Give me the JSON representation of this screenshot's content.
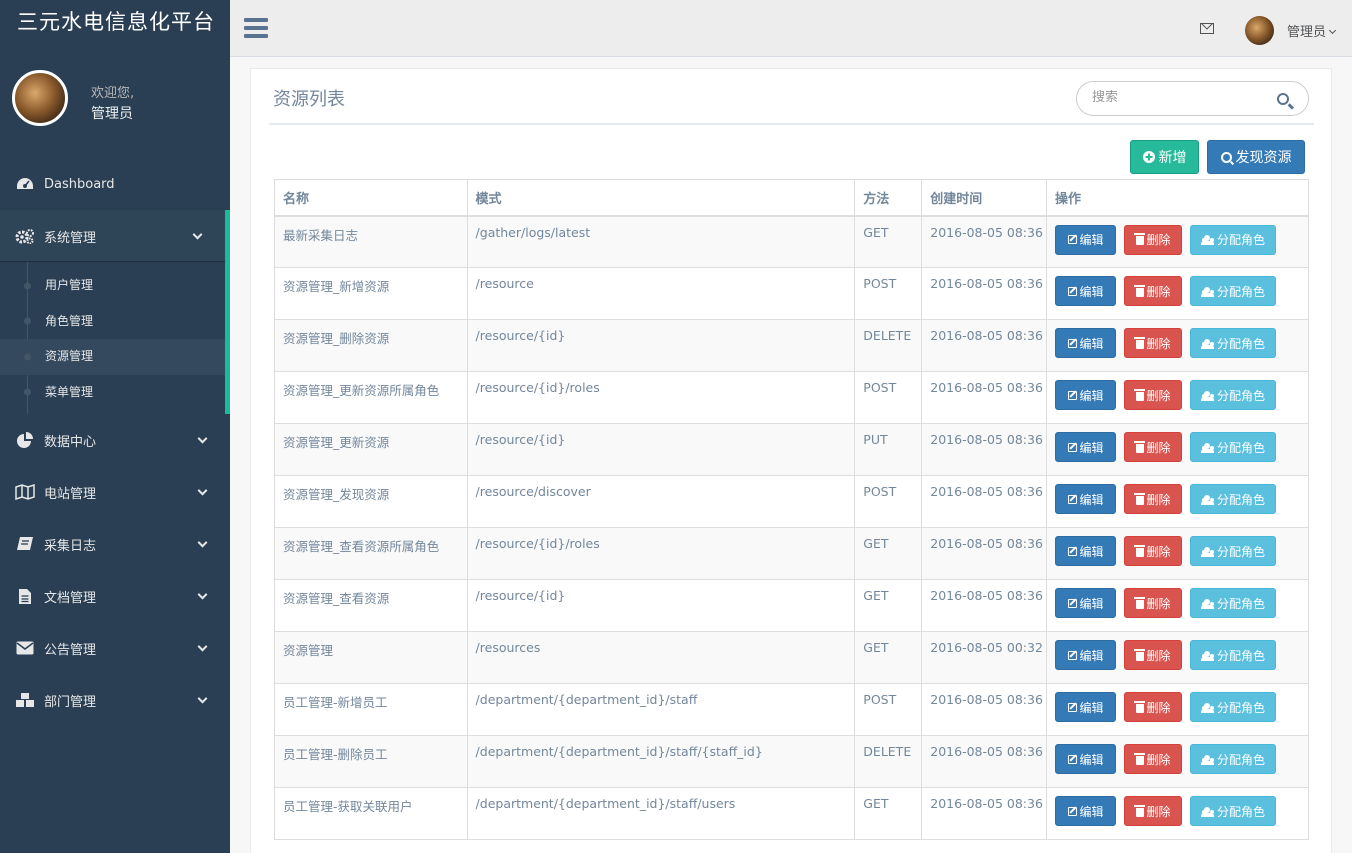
{
  "brand": "三元水电信息化平台",
  "profile": {
    "welcome": "欢迎您,",
    "name": "管理员"
  },
  "menu": [
    {
      "label": "Dashboard",
      "icon": "dashboard-icon"
    },
    {
      "label": "系统管理",
      "icon": "gears-icon"
    },
    {
      "label": "数据中心",
      "icon": "pie-chart-icon"
    },
    {
      "label": "电站管理",
      "icon": "map-icon"
    },
    {
      "label": "采集日志",
      "icon": "book-icon"
    },
    {
      "label": "文档管理",
      "icon": "file-text-icon"
    },
    {
      "label": "公告管理",
      "icon": "envelope-icon"
    },
    {
      "label": "部门管理",
      "icon": "cubes-icon"
    }
  ],
  "submenu": [
    "用户管理",
    "角色管理",
    "资源管理",
    "菜单管理"
  ],
  "topnav": {
    "user": "管理员"
  },
  "panel": {
    "title": "资源列表",
    "search_placeholder": "搜索",
    "add_label": "新增",
    "discover_label": "发现资源"
  },
  "table": {
    "headers": [
      "名称",
      "模式",
      "方法",
      "创建时间",
      "操作"
    ],
    "actions": {
      "edit": "编辑",
      "delete": "删除",
      "assign": "分配角色"
    },
    "rows": [
      {
        "name": "最新采集日志",
        "pattern": "/gather/logs/latest",
        "method": "GET",
        "created": "2016-08-05 08:36"
      },
      {
        "name": "资源管理_新增资源",
        "pattern": "/resource",
        "method": "POST",
        "created": "2016-08-05 08:36"
      },
      {
        "name": "资源管理_删除资源",
        "pattern": "/resource/{id}",
        "method": "DELETE",
        "created": "2016-08-05 08:36"
      },
      {
        "name": "资源管理_更新资源所属角色",
        "pattern": "/resource/{id}/roles",
        "method": "POST",
        "created": "2016-08-05 08:36"
      },
      {
        "name": "资源管理_更新资源",
        "pattern": "/resource/{id}",
        "method": "PUT",
        "created": "2016-08-05 08:36"
      },
      {
        "name": "资源管理_发现资源",
        "pattern": "/resource/discover",
        "method": "POST",
        "created": "2016-08-05 08:36"
      },
      {
        "name": "资源管理_查看资源所属角色",
        "pattern": "/resource/{id}/roles",
        "method": "GET",
        "created": "2016-08-05 08:36"
      },
      {
        "name": "资源管理_查看资源",
        "pattern": "/resource/{id}",
        "method": "GET",
        "created": "2016-08-05 08:36"
      },
      {
        "name": "资源管理",
        "pattern": "/resources",
        "method": "GET",
        "created": "2016-08-05 00:32"
      },
      {
        "name": "员工管理-新增员工",
        "pattern": "/department/{department_id}/staff",
        "method": "POST",
        "created": "2016-08-05 08:36"
      },
      {
        "name": "员工管理-删除员工",
        "pattern": "/department/{department_id}/staff/{staff_id}",
        "method": "DELETE",
        "created": "2016-08-05 08:36"
      },
      {
        "name": "员工管理-获取关联用户",
        "pattern": "/department/{department_id}/staff/users",
        "method": "GET",
        "created": "2016-08-05 08:36"
      }
    ]
  }
}
